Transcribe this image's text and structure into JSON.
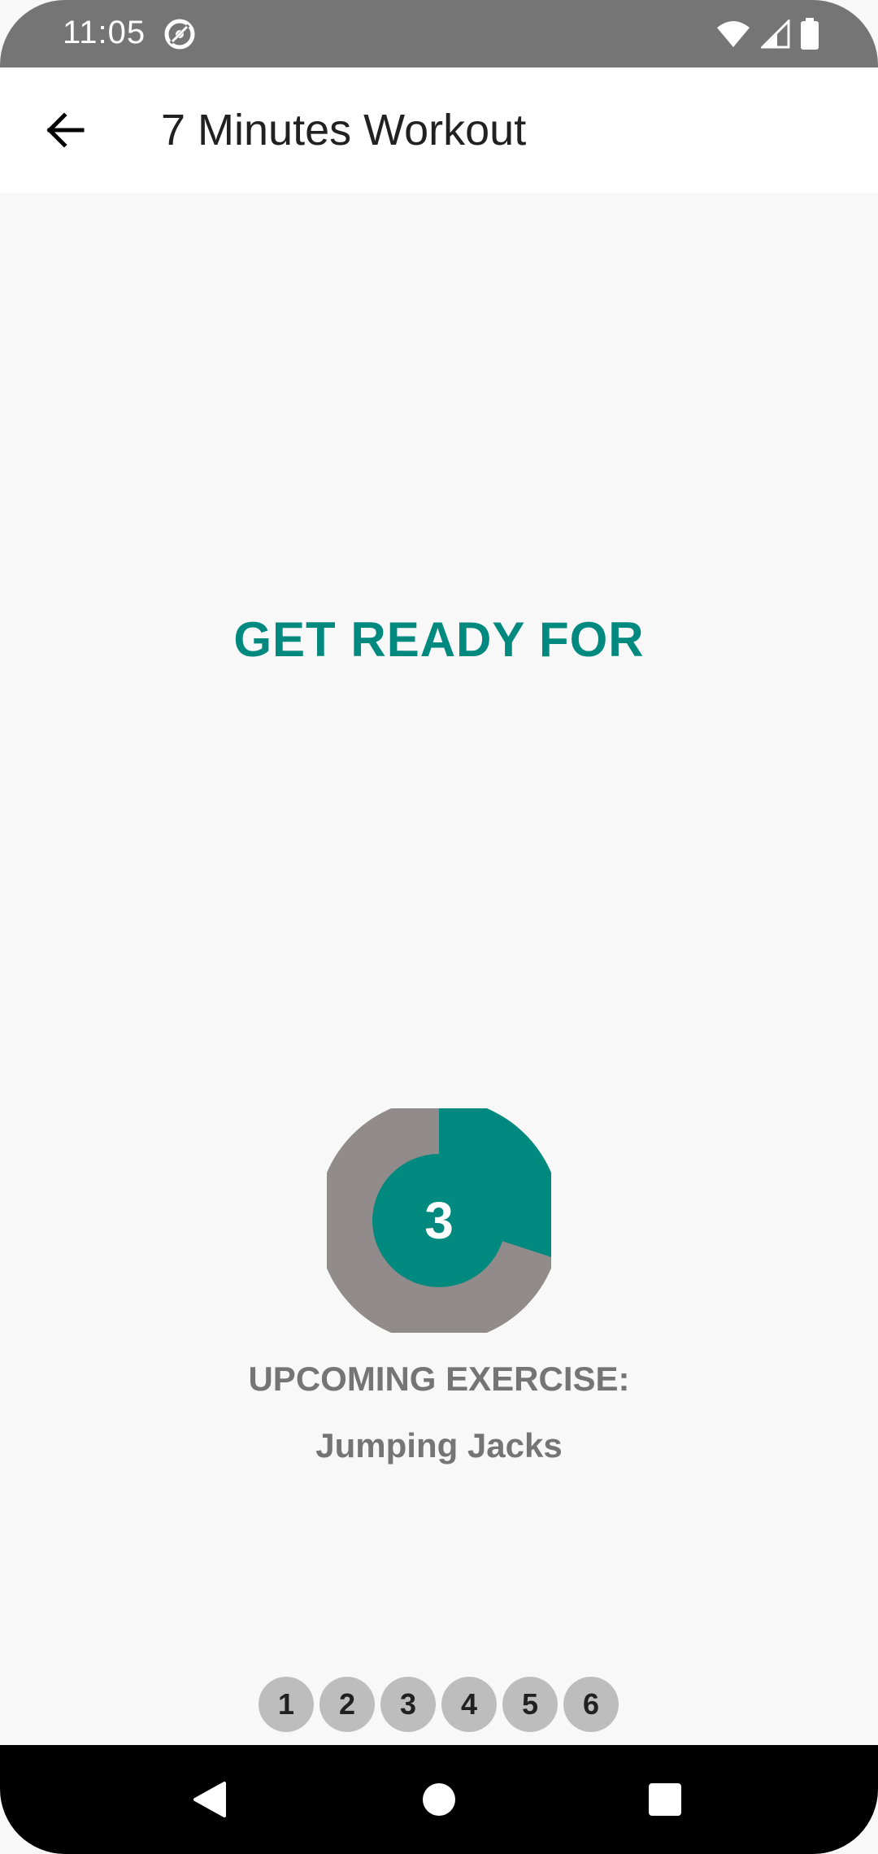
{
  "status_bar": {
    "time": "11:05",
    "icons": [
      "sync-icon",
      "wifi-icon",
      "signal-icon",
      "battery-icon"
    ]
  },
  "app_bar": {
    "title": "7 Minutes Workout",
    "back_icon": "arrow-back-icon"
  },
  "main": {
    "get_ready_label": "GET READY FOR",
    "timer": {
      "value": "3",
      "progress_fraction": 0.3
    },
    "upcoming_label": "UPCOMING EXERCISE:",
    "upcoming_exercise": "Jumping Jacks",
    "steps": [
      "1",
      "2",
      "3",
      "4",
      "5",
      "6"
    ]
  },
  "nav_bar": {
    "icons": [
      "back-triangle-icon",
      "home-circle-icon",
      "recents-square-icon"
    ]
  },
  "colors": {
    "accent": "#00897f",
    "timer_track": "#928b8b",
    "status_bar": "#757575",
    "step_bg": "#bdbdbd"
  }
}
